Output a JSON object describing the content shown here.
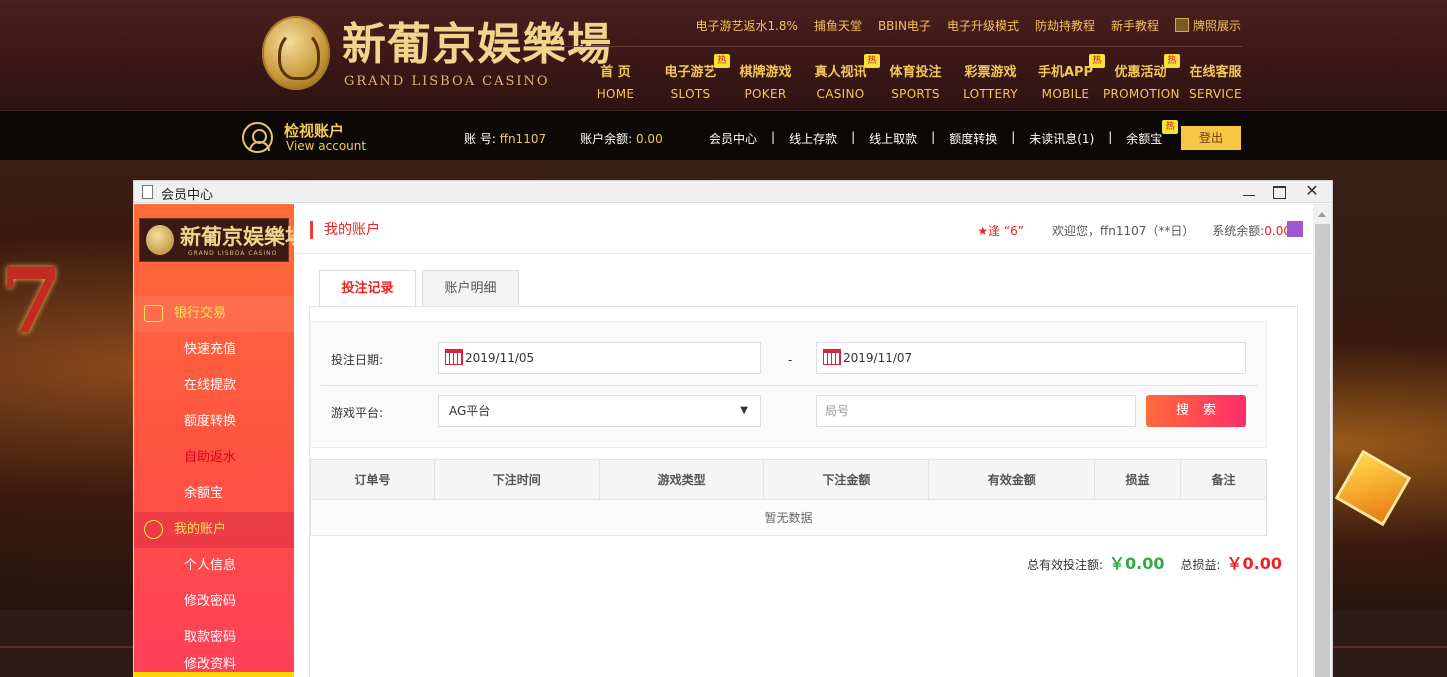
{
  "header": {
    "logo_cn": "新葡京娱樂場",
    "logo_en": "GRAND LISBOA CASINO",
    "top_links": [
      "电子游艺返水1.8%",
      "捕鱼天堂",
      "BBIN电子",
      "电子升级模式",
      "防劫持教程",
      "新手教程",
      "牌照展示"
    ],
    "nav": [
      {
        "cn": "首 页",
        "en": "HOME",
        "hot": false
      },
      {
        "cn": "电子游艺",
        "en": "SLOTS",
        "hot": true
      },
      {
        "cn": "棋牌游戏",
        "en": "POKER",
        "hot": false
      },
      {
        "cn": "真人视讯",
        "en": "CASINO",
        "hot": true
      },
      {
        "cn": "体育投注",
        "en": "SPORTS",
        "hot": false
      },
      {
        "cn": "彩票游戏",
        "en": "LOTTERY",
        "hot": false
      },
      {
        "cn": "手机APP",
        "en": "MOBILE",
        "hot": true
      },
      {
        "cn": "优惠活动",
        "en": "PROMOTION",
        "hot": true
      },
      {
        "cn": "在线客服",
        "en": "SERVICE",
        "hot": false
      }
    ],
    "hot_label": "热"
  },
  "account_bar": {
    "title": "检视账户",
    "subtitle": "View account",
    "account_label": "账 号:",
    "account_value": "ffn1107",
    "balance_label": "账户余额:",
    "balance_value": "0.00",
    "links": [
      "会员中心",
      "线上存款",
      "线上取款",
      "额度转换",
      "未读讯息(1)",
      "余额宝"
    ],
    "separator": "|",
    "logout": "登出"
  },
  "window": {
    "title": "会员中心",
    "close": "✕"
  },
  "sidebar": {
    "logo_cn": "新葡京娱樂場",
    "logo_en": "GRAND LISBOA CASINO",
    "section1": "银行交易",
    "section1_items": [
      "快速充值",
      "在线提款",
      "额度转换",
      "自助返水",
      "余额宝"
    ],
    "section2": "我的账户",
    "section2_items": [
      "个人信息",
      "修改密码",
      "取款密码",
      "修改资料"
    ]
  },
  "main": {
    "page_title": "我的账户",
    "star_text": "★逢 “6”",
    "welcome": "欢迎您，ffn1107（**日）",
    "sys_balance_label": "系统余额:",
    "sys_balance_value": "0.00",
    "tabs": [
      "投注记录",
      "账户明细"
    ],
    "form": {
      "date_label": "投注日期:",
      "date_from": "2019/11/05",
      "date_sep": "-",
      "date_to": "2019/11/07",
      "platform_label": "游戏平台:",
      "platform_value": "AG平台",
      "round_placeholder": "局号",
      "search": "搜索"
    },
    "table": {
      "headers": [
        "订单号",
        "下注时间",
        "游戏类型",
        "下注金额",
        "有效金额",
        "损益",
        "备注"
      ],
      "empty": "暂无数据"
    },
    "totals": {
      "valid_label": "总有效投注额:",
      "valid_value": "￥0.00",
      "pl_label": "总损益:",
      "pl_value": "￥0.00"
    }
  }
}
